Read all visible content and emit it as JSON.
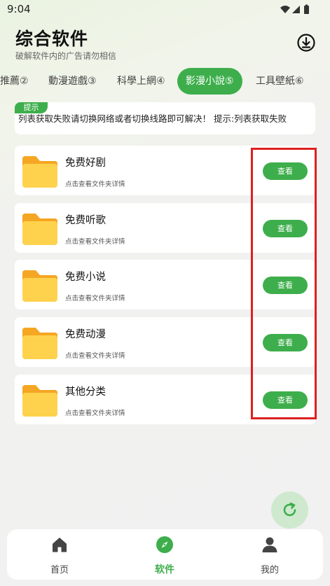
{
  "status_bar": {
    "time": "9:04"
  },
  "header": {
    "title": "综合软件",
    "subtitle": "破解软件内的广告请勿相信"
  },
  "tabs": [
    {
      "label": "推薦②"
    },
    {
      "label": "動漫遊戲③"
    },
    {
      "label": "科學上網④"
    },
    {
      "label": "影漫小說⑤",
      "active": true
    },
    {
      "label": "工具壁紙⑥"
    }
  ],
  "notice": {
    "badge": "提示",
    "text": "列表获取失败请切换网络或者切换线路即可解决！    提示:列表获取失败"
  },
  "items": [
    {
      "title": "免费好剧",
      "desc": "点击查看文件夹详情",
      "button": "查看"
    },
    {
      "title": "免费听歌",
      "desc": "点击查看文件夹详情",
      "button": "查看"
    },
    {
      "title": "免费小说",
      "desc": "点击查看文件夹详情",
      "button": "查看"
    },
    {
      "title": "免费动漫",
      "desc": "点击查看文件夹详情",
      "button": "查看"
    },
    {
      "title": "其他分类",
      "desc": "点击查看文件夹详情",
      "button": "查看"
    }
  ],
  "bottom_nav": [
    {
      "label": "首页",
      "icon": "home-icon"
    },
    {
      "label": "软件",
      "icon": "compass-icon",
      "active": true
    },
    {
      "label": "我的",
      "icon": "person-icon"
    }
  ],
  "colors": {
    "accent": "#3dae4b",
    "highlight": "#dd2020",
    "folder": "#ffd24d",
    "folder_tab": "#f5a623"
  }
}
